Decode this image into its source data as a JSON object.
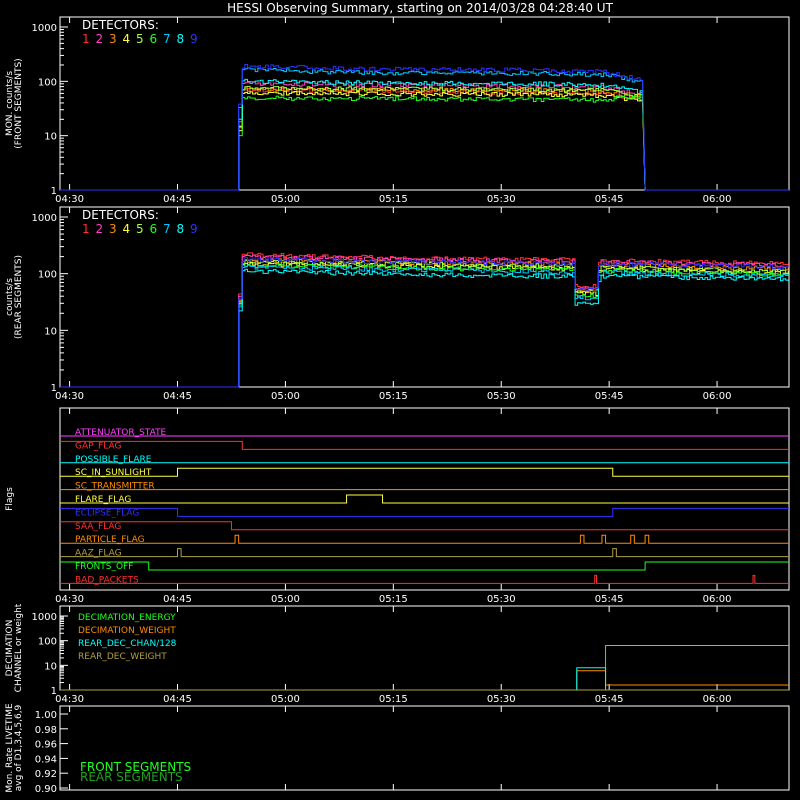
{
  "title": "HESSI Observing Summary, starting on 2014/03/28 04:28:40 UT",
  "time_axis": {
    "start": "04:28:40",
    "end": "06:10:00",
    "ticks": [
      "04:30",
      "04:45",
      "05:00",
      "05:15",
      "05:30",
      "05:45",
      "06:00"
    ]
  },
  "detector_colors": [
    "#ff3030",
    "#ff40c0",
    "#ff8c00",
    "#ffff40",
    "#a0ff40",
    "#20ff20",
    "#00c8ff",
    "#00ffff",
    "#3030ff"
  ],
  "panels": {
    "front": {
      "ylabel_line1": "MON. counts/s",
      "ylabel_line2": "(FRONT SEGMENTS)",
      "legend_title": "DETECTORS:",
      "legend_numbers": [
        "1",
        "2",
        "3",
        "4",
        "5",
        "6",
        "7",
        "8",
        "9"
      ],
      "yticks": [
        "1000",
        "100",
        "10",
        "1"
      ]
    },
    "rear": {
      "ylabel_line1": "counts/s",
      "ylabel_line2": "(REAR SEGMENTS)",
      "legend_title": "DETECTORS:",
      "legend_numbers": [
        "1",
        "2",
        "3",
        "4",
        "5",
        "6",
        "7",
        "8",
        "9"
      ],
      "yticks": [
        "1000",
        "100",
        "10",
        "1"
      ]
    },
    "flags": {
      "ylabel": "Flags"
    },
    "decimation": {
      "ylabel_line1": "DECIMATION",
      "ylabel_line2": "CHANNEL or weight",
      "yticks": [
        "1000",
        "100",
        "10",
        "1"
      ]
    },
    "livetime": {
      "ylabel_line1": "Mon. Rate LIVETIME",
      "ylabel_line2": "avg of D1,3,4,5,6,9",
      "yticks": [
        "1.00",
        "0.98",
        "0.96",
        "0.94",
        "0.92",
        "0.90"
      ],
      "legend": [
        {
          "label": "FRONT SEGMENTS",
          "color": "#20ff20"
        },
        {
          "label": "REAR SEGMENTS",
          "color": "#20a020"
        }
      ]
    }
  },
  "chart_data": [
    {
      "type": "line",
      "panel": "front",
      "ylog": true,
      "ylim": [
        1,
        1000
      ],
      "x_start": "04:28:40",
      "data_on": "04:54:00",
      "data_off": "05:50:00",
      "series": [
        {
          "name": "1",
          "values": [
            1,
            70,
            68,
            65,
            62,
            60,
            45
          ]
        },
        {
          "name": "2",
          "values": [
            1,
            90,
            88,
            85,
            80,
            78,
            55
          ]
        },
        {
          "name": "3",
          "values": [
            1,
            72,
            70,
            70,
            68,
            65,
            50
          ]
        },
        {
          "name": "4",
          "values": [
            1,
            62,
            60,
            58,
            58,
            55,
            40
          ]
        },
        {
          "name": "5",
          "values": [
            1,
            75,
            73,
            72,
            70,
            68,
            52
          ]
        },
        {
          "name": "6",
          "values": [
            1,
            50,
            48,
            48,
            46,
            45,
            55
          ]
        },
        {
          "name": "7",
          "values": [
            1,
            165,
            150,
            140,
            140,
            135,
            90
          ]
        },
        {
          "name": "8",
          "values": [
            1,
            100,
            95,
            92,
            90,
            85,
            60
          ]
        },
        {
          "name": "9",
          "values": [
            1,
            190,
            175,
            165,
            160,
            150,
            100
          ]
        }
      ],
      "x": [
        "04:53:30",
        "04:54:00",
        "05:05:00",
        "05:20:00",
        "05:35:00",
        "05:44:00",
        "05:50:00"
      ]
    },
    {
      "type": "line",
      "panel": "rear",
      "ylog": true,
      "ylim": [
        1,
        1000
      ],
      "series": [
        {
          "name": "1",
          "values": [
            1,
            220,
            200,
            185,
            175,
            60,
            170,
            150
          ]
        },
        {
          "name": "2",
          "values": [
            1,
            200,
            190,
            175,
            165,
            55,
            160,
            140
          ]
        },
        {
          "name": "3",
          "values": [
            1,
            170,
            165,
            155,
            145,
            50,
            140,
            120
          ]
        },
        {
          "name": "4",
          "values": [
            1,
            150,
            145,
            135,
            125,
            45,
            120,
            100
          ]
        },
        {
          "name": "5",
          "values": [
            1,
            160,
            155,
            145,
            135,
            48,
            130,
            110
          ]
        },
        {
          "name": "6",
          "values": [
            1,
            140,
            135,
            125,
            115,
            40,
            115,
            95
          ]
        },
        {
          "name": "7",
          "values": [
            1,
            130,
            125,
            115,
            105,
            38,
            105,
            90
          ]
        },
        {
          "name": "8",
          "values": [
            1,
            110,
            105,
            95,
            90,
            30,
            90,
            80
          ]
        },
        {
          "name": "9",
          "values": [
            1,
            180,
            170,
            160,
            150,
            52,
            150,
            130
          ]
        }
      ],
      "x": [
        "04:53:30",
        "04:54:00",
        "05:05:00",
        "05:20:00",
        "05:40:00",
        "05:41:30",
        "05:44:00",
        "06:10:00"
      ]
    },
    {
      "type": "line",
      "panel": "flags",
      "series": [
        {
          "name": "ATTENUATOR_STATE",
          "color": "#ff40ff",
          "steps": [
            [
              "04:28:40",
              0
            ]
          ]
        },
        {
          "name": "GAP_FLAG",
          "color": "#ff3030",
          "steps": [
            [
              "04:28:40",
              1
            ],
            [
              "04:54:00",
              0
            ]
          ]
        },
        {
          "name": "POSSIBLE_FLARE",
          "color": "#00ffff",
          "steps": [
            [
              "04:28:40",
              0
            ]
          ]
        },
        {
          "name": "SC_IN_SUNLIGHT",
          "color": "#ffff40",
          "steps": [
            [
              "04:28:40",
              0
            ],
            [
              "04:45:00",
              1
            ],
            [
              "05:45:30",
              0
            ]
          ]
        },
        {
          "name": "SC_TRANSMITTER",
          "color": "#ff8c00",
          "steps": [
            [
              "04:28:40",
              0
            ]
          ]
        },
        {
          "name": "FLARE_FLAG",
          "color": "#ffff40",
          "steps": [
            [
              "04:28:40",
              0
            ],
            [
              "05:08:30",
              1
            ],
            [
              "05:13:30",
              0
            ]
          ]
        },
        {
          "name": "ECLIPSE_FLAG",
          "color": "#3030ff",
          "steps": [
            [
              "04:28:40",
              1
            ],
            [
              "04:45:00",
              0
            ],
            [
              "05:45:30",
              1
            ]
          ]
        },
        {
          "name": "SAA_FLAG",
          "color": "#ff3030",
          "steps": [
            [
              "04:28:40",
              1
            ],
            [
              "04:52:30",
              0
            ]
          ]
        },
        {
          "name": "PARTICLE_FLAG",
          "color": "#ff8c00",
          "steps": [
            [
              "04:28:40",
              0
            ],
            [
              "04:53:00",
              1
            ],
            [
              "04:53:30",
              0
            ],
            [
              "05:41:00",
              1
            ],
            [
              "05:41:30",
              0
            ],
            [
              "05:44:00",
              1
            ],
            [
              "05:44:30",
              0
            ],
            [
              "05:48:00",
              1
            ],
            [
              "05:48:30",
              0
            ],
            [
              "05:50:00",
              1
            ],
            [
              "05:50:30",
              0
            ]
          ]
        },
        {
          "name": "AAZ_FLAG",
          "color": "#b0a040",
          "steps": [
            [
              "04:28:40",
              0
            ],
            [
              "04:45:00",
              1
            ],
            [
              "04:45:30",
              0
            ],
            [
              "05:45:30",
              1
            ],
            [
              "05:46:00",
              0
            ]
          ]
        },
        {
          "name": "FRONTS_OFF",
          "color": "#20ff20",
          "steps": [
            [
              "04:28:40",
              1
            ],
            [
              "04:41:00",
              0
            ],
            [
              "05:50:00",
              1
            ]
          ]
        },
        {
          "name": "BAD_PACKETS",
          "color": "#ff3030",
          "steps": [
            [
              "04:28:40",
              0
            ],
            [
              "05:43:00",
              1
            ],
            [
              "05:43:15",
              0
            ],
            [
              "06:05:00",
              1
            ],
            [
              "06:05:15",
              0
            ]
          ]
        }
      ]
    },
    {
      "type": "line",
      "panel": "decimation",
      "ylog": true,
      "ylim": [
        1,
        1000
      ],
      "series": [
        {
          "name": "DECIMATION_ENERGY",
          "color": "#20ff20",
          "steps": [
            [
              "04:28:40",
              1
            ],
            [
              "05:44:30",
              64
            ],
            [
              "06:10:00",
              64
            ]
          ]
        },
        {
          "name": "DECIMATION_WEIGHT",
          "color": "#ff8c00",
          "steps": [
            [
              "04:28:40",
              1
            ],
            [
              "05:40:30",
              6
            ],
            [
              "05:44:30",
              1.6
            ],
            [
              "06:10:00",
              1.6
            ]
          ]
        },
        {
          "name": "REAR_DEC_CHAN/128",
          "color": "#00ffff",
          "steps": [
            [
              "04:28:40",
              1
            ],
            [
              "05:40:30",
              8
            ],
            [
              "05:44:30",
              1
            ],
            [
              "06:10:00",
              1
            ]
          ]
        },
        {
          "name": "REAR_DEC_WEIGHT",
          "color": "#b0a040",
          "steps": [
            [
              "04:28:40",
              1
            ],
            [
              "06:10:00",
              1
            ]
          ]
        }
      ]
    },
    {
      "type": "line",
      "panel": "livetime",
      "ylim": [
        0.9,
        1.0
      ],
      "series": [
        {
          "name": "FRONT SEGMENTS",
          "values": []
        },
        {
          "name": "REAR SEGMENTS",
          "values": []
        }
      ]
    }
  ]
}
